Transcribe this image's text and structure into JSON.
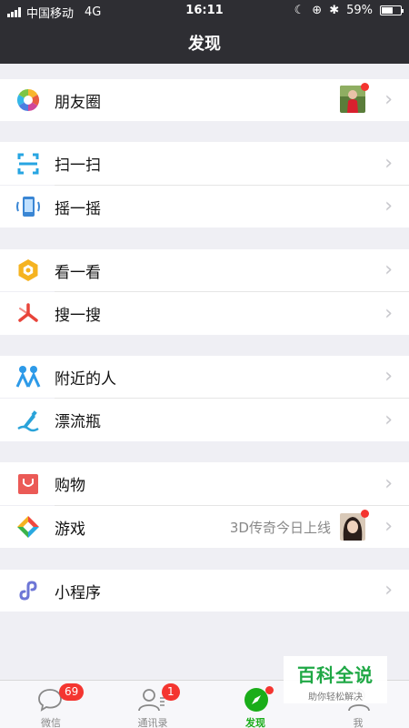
{
  "status_bar": {
    "carrier": "中国移动",
    "network": "4G",
    "time": "16:11",
    "battery": "59%",
    "battery_level": 0.59
  },
  "nav": {
    "title": "发现"
  },
  "items": {
    "moments": {
      "label": "朋友圈",
      "icon": "moments-icon"
    },
    "scan": {
      "label": "扫一扫",
      "icon": "scan-icon"
    },
    "shake": {
      "label": "摇一摇",
      "icon": "shake-icon"
    },
    "look": {
      "label": "看一看",
      "icon": "look-icon"
    },
    "search": {
      "label": "搜一搜",
      "icon": "search-icon"
    },
    "nearby": {
      "label": "附近的人",
      "icon": "nearby-people-icon"
    },
    "bottle": {
      "label": "漂流瓶",
      "icon": "drift-bottle-icon"
    },
    "shopping": {
      "label": "购物",
      "icon": "shopping-icon"
    },
    "games": {
      "label": "游戏",
      "icon": "games-icon",
      "promo": "3D传奇今日上线"
    },
    "mini": {
      "label": "小程序",
      "icon": "mini-program-icon"
    }
  },
  "tabbar": {
    "chats": {
      "label": "微信",
      "badge": "69"
    },
    "contacts": {
      "label": "通讯录",
      "badge": "1"
    },
    "discover": {
      "label": "发现"
    },
    "me": {
      "label": "我"
    }
  },
  "watermark": {
    "title": "百科全说",
    "subtitle": "助你轻松解决"
  },
  "colors": {
    "nav_bg": "#2e2e33",
    "page_bg": "#efeff4",
    "accent_green": "#1aad19",
    "badge_red": "#f43530"
  }
}
